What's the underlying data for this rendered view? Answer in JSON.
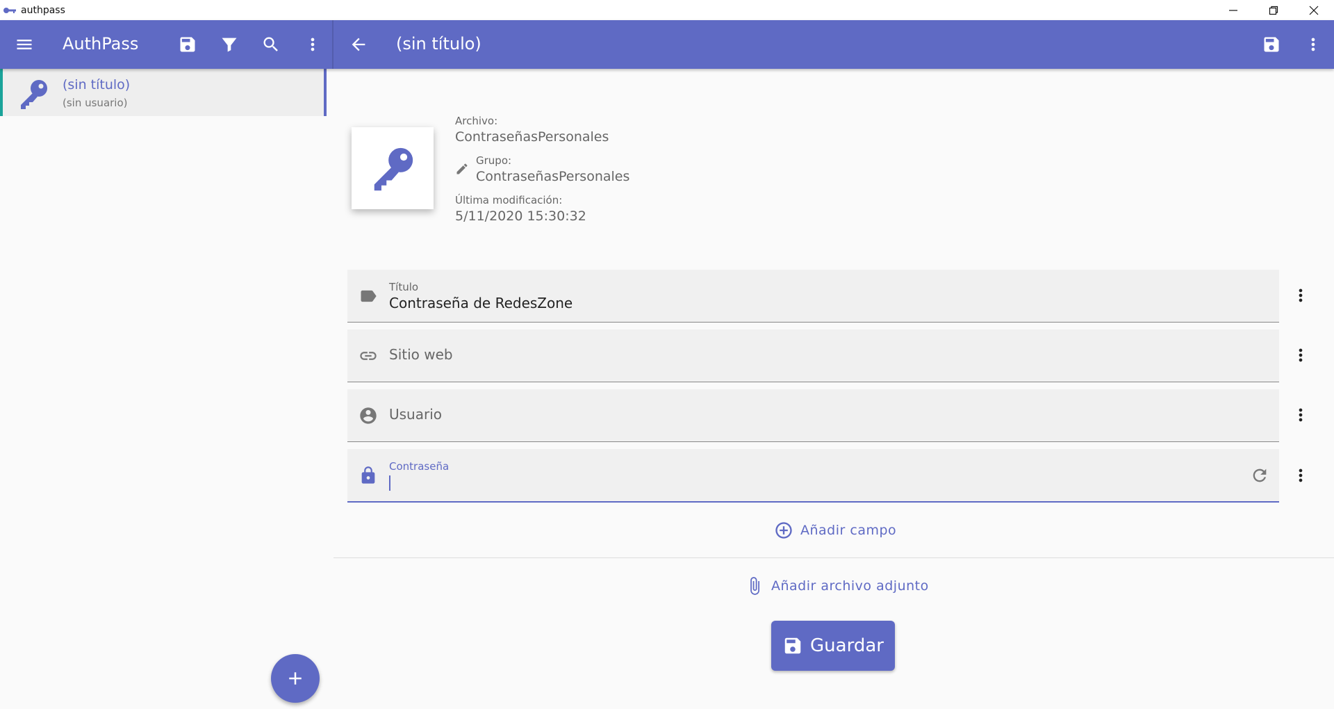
{
  "window": {
    "title": "authpass",
    "controls": [
      "minimize-icon",
      "restore-icon",
      "close-icon"
    ]
  },
  "appbar": {
    "left": {
      "title": "AuthPass",
      "icons": [
        "menu-icon",
        "save-icon",
        "filter-icon",
        "search-icon",
        "more-vert-icon"
      ]
    },
    "right": {
      "title": "(sin título)",
      "icons": [
        "back-arrow-icon",
        "save-icon",
        "more-vert-icon"
      ]
    },
    "color": "#5f6ac4"
  },
  "entry_list": {
    "items": [
      {
        "title": "(sin título)",
        "subtitle": "(sin usuario)",
        "icon": "key-icon",
        "selected": true
      }
    ]
  },
  "details": {
    "file_label": "Archivo:",
    "file_value": "ContraseñasPersonales",
    "group_label": "Grupo:",
    "group_value": "ContraseñasPersonales",
    "modified_label": "Última modificación:",
    "modified_value": "5/11/2020 15:30:32"
  },
  "fields": {
    "title": {
      "label": "Título",
      "value": "Contraseña de RedesZone",
      "icon": "label-icon"
    },
    "website": {
      "placeholder": "Sitio web",
      "icon": "link-icon"
    },
    "username": {
      "placeholder": "Usuario",
      "icon": "account-circle-icon"
    },
    "password": {
      "label": "Contraseña",
      "value": "",
      "icon": "lock-icon"
    }
  },
  "actions": {
    "add_field": "Añadir campo",
    "add_attachment": "Añadir archivo adjunto",
    "save": "Guardar"
  },
  "colors": {
    "primary": "#5f6ac4",
    "selection_accent": "#1aa39a"
  }
}
